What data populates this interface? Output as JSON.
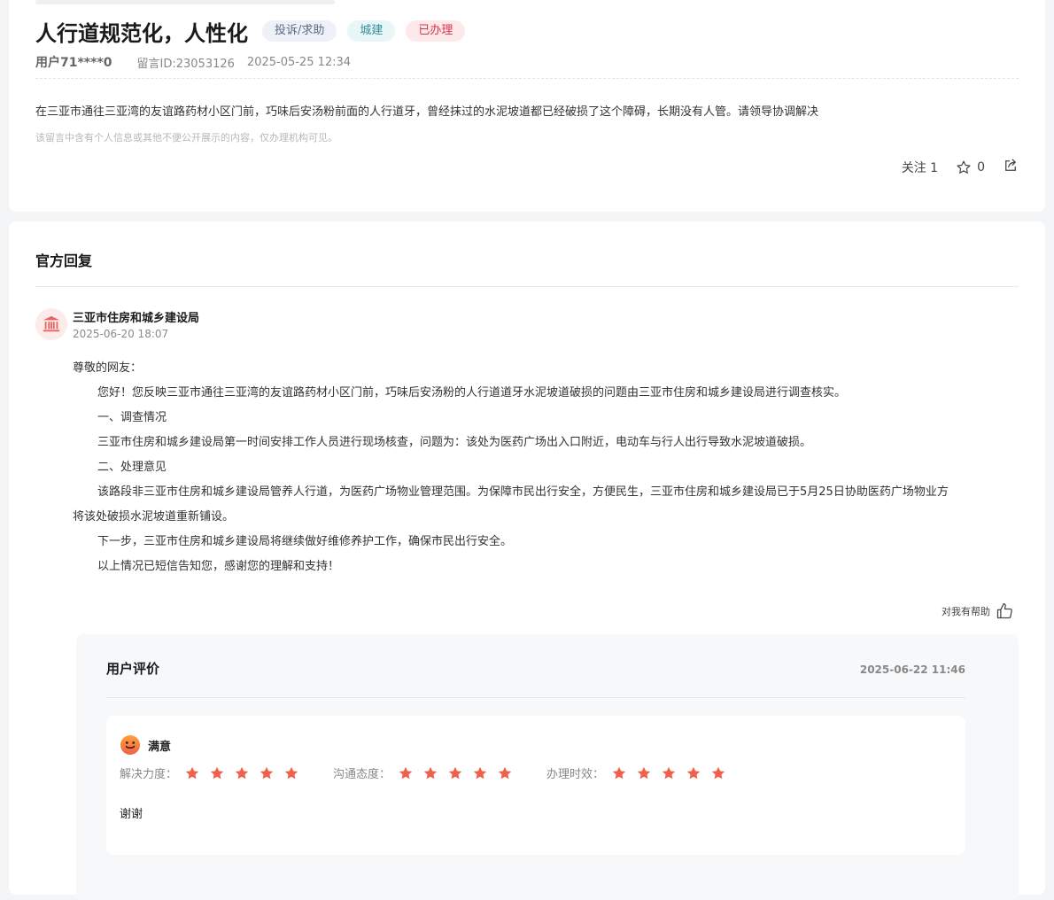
{
  "post": {
    "title": "人行道规范化，人性化",
    "tags": {
      "category": "投诉/求助",
      "department": "城建",
      "status": "已办理"
    },
    "user": "用户71****0",
    "message_id": "留言ID:23053126",
    "time": "2025-05-25 12:34",
    "content": "在三亚市通往三亚湾的友谊路药材小区门前，巧味后安汤粉前面的人行道牙，曾经抹过的水泥坡道都已经破损了这个障碍，长期没有人管。请领导协调解决",
    "privacy_note": "该留言中含有个人信息或其他不便公开展示的内容，仅办理机构可见。",
    "follow_label": "关注",
    "follow_count": "1",
    "favorite_count": "0"
  },
  "reply": {
    "section_title": "官方回复",
    "department": "三亚市住房和城乡建设局",
    "time": "2025-06-20 18:07",
    "greeting": "尊敬的网友：",
    "p1": "您好！您反映三亚市通往三亚湾的友谊路药材小区门前，巧味后安汤粉的人行道道牙水泥坡道破损的问题由三亚市住房和城乡建设局进行调查核实。",
    "h1": "一、调查情况",
    "p2": " 三亚市住房和城乡建设局第一时间安排工作人员进行现场核查，问题为：该处为医药广场出入口附近，电动车与行人出行导致水泥坡道破损。",
    "h2": "二、处理意见",
    "p3a": " 该路段非三亚市住房和城乡建设局管养人行道，为医药广场物业管理范围。为保障市民出行安全，方便民生，三亚市住房和城乡建设局已于5月25日协助医药广场物业方",
    "p3b": "将该处破损水泥坡道重新铺设。",
    "p4": "下一步，三亚市住房和城乡建设局将继续做好维修养护工作，确保市民出行安全。",
    "p5": "以上情况已短信告知您，感谢您的理解和支持！",
    "helpful_label": "对我有帮助"
  },
  "evaluation": {
    "title": "用户评价",
    "time": "2025-06-22 11:46",
    "satisfaction": "满意",
    "ratings": [
      {
        "label": "解决力度：",
        "stars": 5
      },
      {
        "label": "沟通态度：",
        "stars": 5
      },
      {
        "label": "办理时效：",
        "stars": 5
      }
    ],
    "comment": "谢谢"
  },
  "colors": {
    "star": "#f0614b",
    "status_tag": "#d8344a",
    "dept_icon": "#e8655f"
  },
  "icons": {
    "favorite": "star-outline-icon",
    "share": "share-icon",
    "department": "government-building-icon",
    "helpful": "thumbs-up-icon",
    "satisfaction": "smiley-face-icon"
  }
}
